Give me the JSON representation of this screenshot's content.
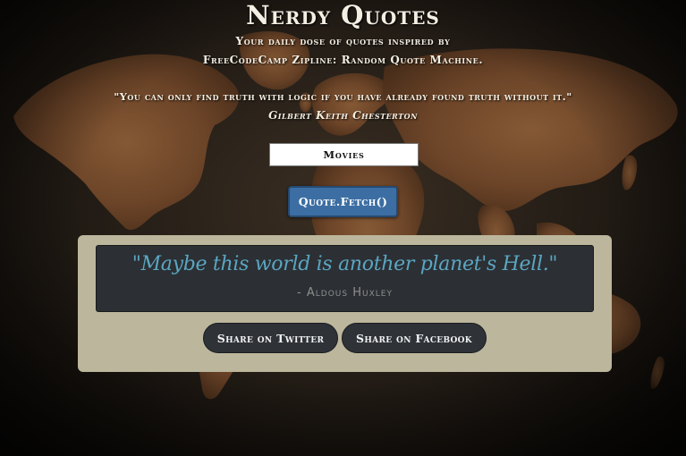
{
  "header": {
    "title": "Nerdy Quotes",
    "subtitle_line1": "Your daily dose of quotes inspired by",
    "subtitle_line2": "FreeCodeCamp Zipline: Random Quote Machine."
  },
  "daily": {
    "quote": "\"You can only find truth with logic if you have already found truth without it.\"",
    "author": "Gilbert Keith Chesterton"
  },
  "controls": {
    "category_selected": "Movies",
    "fetch_label": "Quote.Fetch()"
  },
  "result": {
    "quote": "\"Maybe this world is another planet's Hell.\"",
    "author": "- Aldous Huxley"
  },
  "share": {
    "twitter_label": "Share on Twitter",
    "facebook_label": "Share on Facebook"
  },
  "colors": {
    "fetch_button": "#3c6ea3",
    "panel": "#bcb69c",
    "quote_box": "#2c2f33",
    "quote_text": "#5aa6c2"
  }
}
